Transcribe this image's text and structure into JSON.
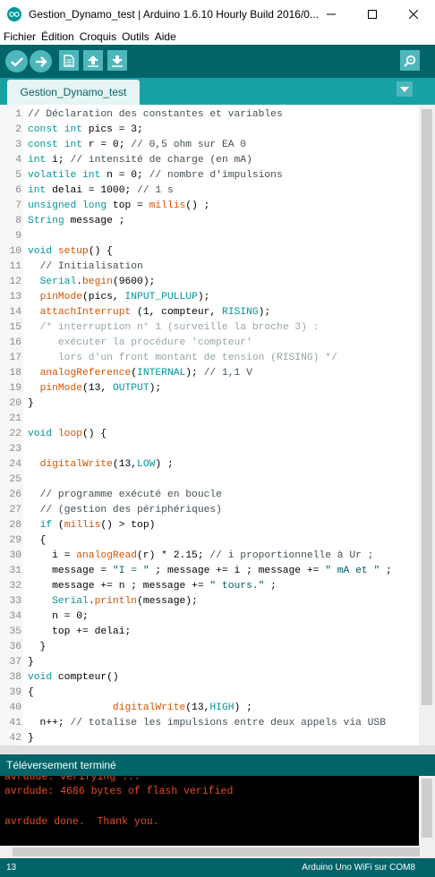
{
  "window": {
    "title": "Gestion_Dynamo_test | Arduino 1.6.10 Hourly Build 2016/0..."
  },
  "menu": [
    "Fichier",
    "Édition",
    "Croquis",
    "Outils",
    "Aide"
  ],
  "toolbar": {
    "buttons": [
      "verify-icon",
      "upload-icon",
      "new-icon",
      "open-icon",
      "save-icon",
      "serial-monitor-icon"
    ]
  },
  "tabs": [
    {
      "label": "Gestion_Dynamo_test"
    }
  ],
  "editor": {
    "lines": [
      "// Déclaration des constantes et variables",
      "const int pics = 3;",
      "const int r = 0; // 0,5 ohm sur EA 0",
      "int i; // intensité de charge (en mA)",
      "volatile int n = 0; // nombre d'impulsions",
      "int delai = 1000; // 1 s",
      "unsigned long top = millis() ;",
      "String message ;",
      "",
      "void setup() {",
      "  // Initialisation",
      "  Serial.begin(9600);",
      "  pinMode(pics, INPUT_PULLUP);",
      "  attachInterrupt (1, compteur, RISING);",
      "  /* interruption n° 1 (surveille la broche 3) :",
      "     exécuter la procédure 'compteur'",
      "     lors d'un front montant de tension (RISING) */",
      "  analogReference(INTERNAL); // 1,1 V",
      "  pinMode(13, OUTPUT);",
      "}",
      "",
      "void loop() {",
      "",
      "  digitalWrite(13,LOW) ;",
      "",
      "  // programme exécuté en boucle",
      "  // (gestion des périphériques)",
      "  if (millis() > top)",
      "  {",
      "    i = analogRead(r) * 2.15; // i proportionnelle à Ur ;",
      "    message = \"I = \" ; message += i ; message += \" mA et \" ;",
      "    message += n ; message += \" tours.\" ;",
      "    Serial.println(message);",
      "    n = 0;",
      "    top += delai;",
      "  }",
      "}",
      "void compteur()",
      "{",
      "              digitalWrite(13,HIGH) ;",
      "  n++; // totalise les impulsions entre deux appels via USB",
      "}"
    ]
  },
  "status": {
    "message": "Téléversement terminé"
  },
  "console": {
    "lines": [
      "avrdude: verifying ...",
      "avrdude: 4686 bytes of flash verified",
      "",
      "avrdude done.  Thank you."
    ]
  },
  "footer": {
    "line_number": "13",
    "board": "Arduino Uno WiFi sur COM8"
  },
  "colors": {
    "toolbar": "#006468",
    "tabbar": "#17a1a5",
    "keyword": "#00979c",
    "function": "#d35400",
    "console_text": "#e34c22"
  }
}
